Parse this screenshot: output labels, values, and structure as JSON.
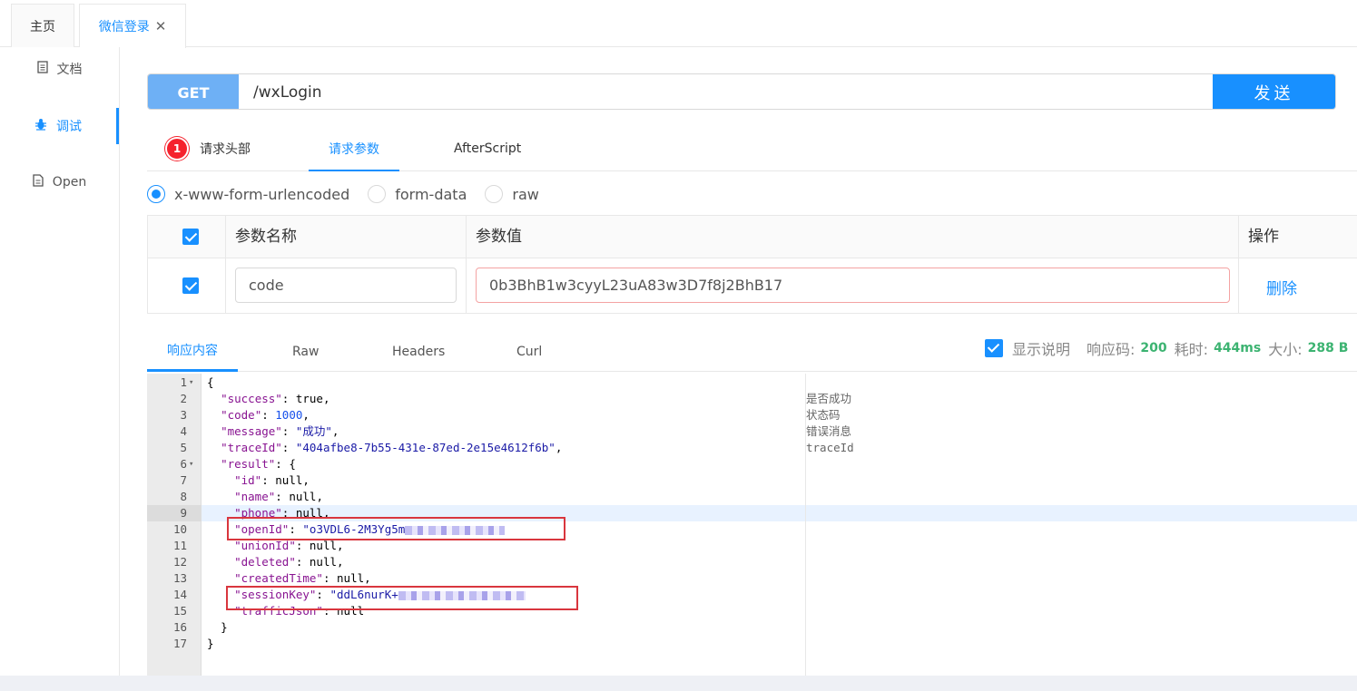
{
  "tabs": {
    "home": "主页",
    "wx_login": "微信登录",
    "close_glyph": "✕"
  },
  "sidebar": {
    "doc": "文档",
    "debug": "调试",
    "open": "Open"
  },
  "request": {
    "method": "GET",
    "url": "/wxLogin",
    "send": "发送"
  },
  "req_tabs": {
    "badge_count": "1",
    "headers": "请求头部",
    "params": "请求参数",
    "after_script": "AfterScript"
  },
  "body_types": {
    "urlencoded": "x-www-form-urlencoded",
    "form_data": "form-data",
    "raw": "raw",
    "selected": "x-www-form-urlencoded"
  },
  "params_table": {
    "col_name": "参数名称",
    "col_value": "参数值",
    "col_action": "操作",
    "rows": [
      {
        "checked": true,
        "name": "code",
        "value": "0b3BhB1w3cyyL23uA83w3D7f8j2BhB17",
        "action": "删除"
      }
    ]
  },
  "response": {
    "tabs": {
      "content": "响应内容",
      "raw": "Raw",
      "headers": "Headers",
      "curl": "Curl"
    },
    "show_desc_label": "显示说明",
    "show_desc_checked": true,
    "status_label": "响应码:",
    "status": "200",
    "time_label": "耗时:",
    "time": "444ms",
    "size_label": "大小:",
    "size": "288 B"
  },
  "code": {
    "line_numbers": [
      "1",
      "2",
      "3",
      "4",
      "5",
      "6",
      "7",
      "8",
      "9",
      "10",
      "11",
      "12",
      "13",
      "14",
      "15",
      "16",
      "17"
    ],
    "fold_glyph": "▾",
    "lines": {
      "l1": "{",
      "l2_key": "\"success\"",
      "l2_val": "true",
      "l3_key": "\"code\"",
      "l3_val": "1000",
      "l4_key": "\"message\"",
      "l4_val": "\"成功\"",
      "l5_key": "\"traceId\"",
      "l5_val": "\"404afbe8-7b55-431e-87ed-2e15e4612f6b\"",
      "l6_key": "\"result\"",
      "l7_key": "\"id\"",
      "l7_val": "null",
      "l8_key": "\"name\"",
      "l8_val": "null",
      "l9_key": "\"phone\"",
      "l9_val": "null",
      "l10_key": "\"openId\"",
      "l10_val": "\"o3VDL6-2M3Yg5m",
      "l11_key": "\"unionId\"",
      "l11_val": "null",
      "l12_key": "\"deleted\"",
      "l12_val": "null",
      "l13_key": "\"createdTime\"",
      "l13_val": "null",
      "l14_key": "\"sessionKey\"",
      "l14_val": "\"ddL6nurK+",
      "l15_key": "\"trafficJson\"",
      "l15_val": "null",
      "l16": "}",
      "l17": "}"
    },
    "descriptions": {
      "success": "是否成功",
      "code": "状态码",
      "message": "错误消息",
      "traceId": "traceId"
    }
  }
}
